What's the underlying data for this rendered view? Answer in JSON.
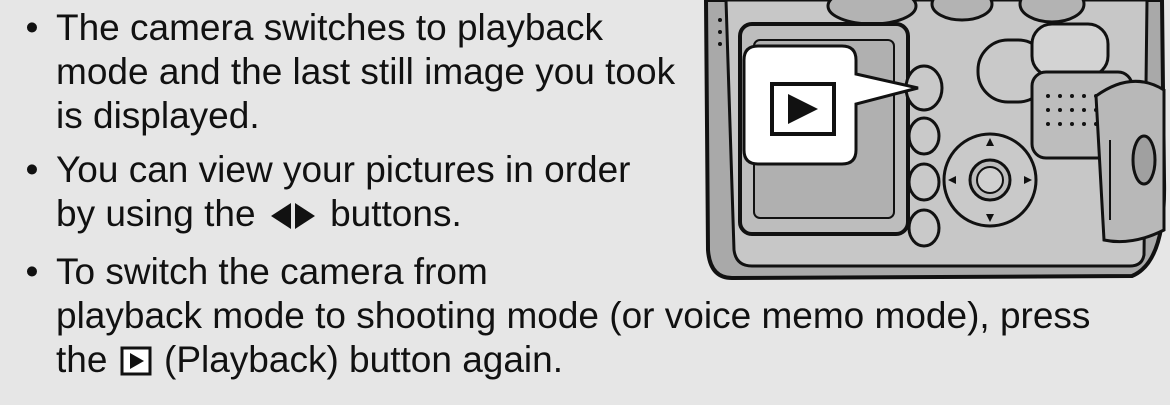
{
  "bullets": [
    {
      "text": "The camera switches to playback mode and the last still image you took is displayed."
    },
    {
      "before": "You can view your pictures in order by using the",
      "icon": "left-right-arrows-icon",
      "after": "buttons."
    },
    {
      "line1": "To switch the camera from",
      "line2": "playback mode to shooting mode (or voice memo mode), press",
      "line3_before": "the",
      "icon": "playback-icon",
      "line3_after": "(Playback) button again."
    }
  ],
  "bullet_symbol": "•",
  "illustration": {
    "subject": "camera-back-illustration",
    "callout_icon": "playback-icon"
  },
  "colors": {
    "background": "#e6e6e6",
    "camera_body": "#a9a9a9",
    "screen": "#bdbdbd",
    "callout": "#ffffff"
  }
}
